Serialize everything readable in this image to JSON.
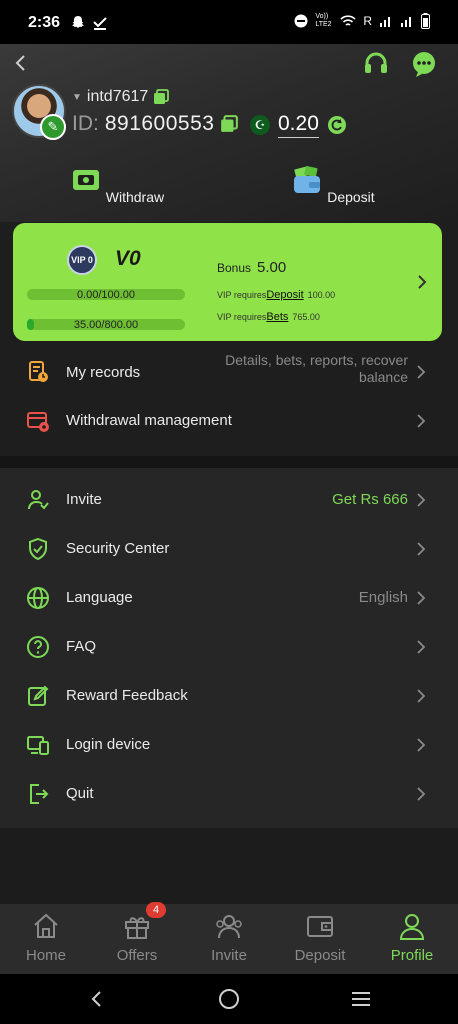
{
  "status_bar": {
    "time": "2:36",
    "network": "Vo)) LTE2",
    "carrier_letter": "R"
  },
  "profile": {
    "username": "intd7617",
    "id_label": "ID:",
    "id_value": "891600553",
    "balance": "0.20"
  },
  "actions": {
    "withdraw": "Withdraw",
    "deposit": "Deposit"
  },
  "vip": {
    "level": "V0",
    "badge_text": "VIP 0",
    "bonus_label": "Bonus",
    "bonus_value": "5.00",
    "progress1_text": "0.00/100.00",
    "progress1_fraction": 0.0,
    "progress2_text": "35.00/800.00",
    "progress2_fraction": 0.044,
    "req1_prefix": "VIP requires",
    "req1_link": "Deposit",
    "req1_value": "100.00",
    "req2_prefix": "VIP requires",
    "req2_link": "Bets",
    "req2_value": "765.00"
  },
  "menu1": {
    "records_label": "My records",
    "records_desc": "Details, bets, reports, recover balance",
    "withdrawal_mgmt_label": "Withdrawal management"
  },
  "menu2": {
    "invite_label": "Invite",
    "invite_value": "Get Rs 666",
    "security_label": "Security Center",
    "language_label": "Language",
    "language_value": "English",
    "faq_label": "FAQ",
    "feedback_label": "Reward Feedback",
    "login_device_label": "Login device",
    "quit_label": "Quit"
  },
  "tabs": {
    "home": "Home",
    "offers": "Offers",
    "offers_badge": "4",
    "invite": "Invite",
    "deposit": "Deposit",
    "profile": "Profile"
  },
  "colors": {
    "accent": "#7ed957",
    "vip_card": "#8fe348",
    "badge_red": "#e03c31",
    "background": "#1e1e1e"
  }
}
